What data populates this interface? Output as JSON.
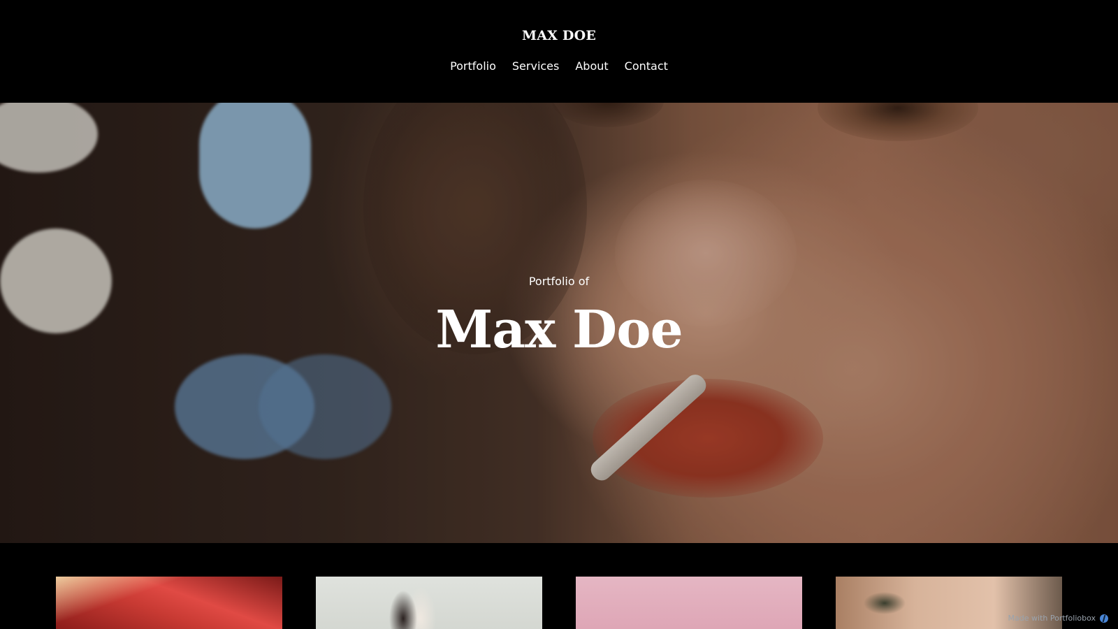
{
  "header": {
    "logo": "MAX DOE",
    "nav": [
      {
        "label": "Portfolio"
      },
      {
        "label": "Services"
      },
      {
        "label": "About"
      },
      {
        "label": "Contact"
      }
    ]
  },
  "hero": {
    "subtitle": "Portfolio of",
    "title": "Max Doe"
  },
  "gallery": {
    "items": [
      {
        "alt": "red-hair-photo"
      },
      {
        "alt": "two-models-photo"
      },
      {
        "alt": "pink-backdrop-photo"
      },
      {
        "alt": "eye-closeup-photo"
      }
    ]
  },
  "footer_badge": {
    "label": "Made with Portfoliobox"
  }
}
